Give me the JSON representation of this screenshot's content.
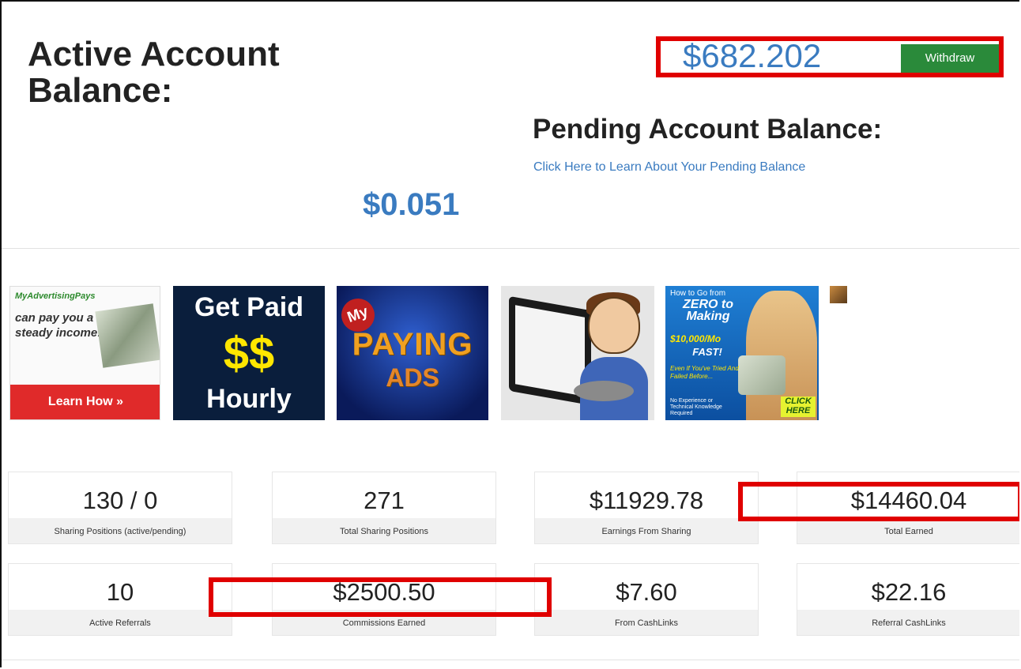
{
  "active_balance": {
    "title": "Active Account Balance:",
    "amount": "$682.202",
    "withdraw_label": "Withdraw"
  },
  "pending_balance": {
    "title": "Pending Account Balance:",
    "link_text": "Click Here to Learn About Your Pending Balance",
    "amount": "$0.051"
  },
  "ads": [
    {
      "brand": "MyAdvertisingPays",
      "text": "can pay you a steady income!",
      "button": "Learn How »"
    },
    {
      "line1": "Get Paid",
      "line2": "$$",
      "line3": "Hourly"
    },
    {
      "line1": "My",
      "line2": "PAYING",
      "line3": "ADS"
    },
    {
      "name": "cartoon-man-tablet"
    },
    {
      "line1": "How to Go from",
      "line2": "ZERO to Making",
      "line3": "$10,000/Mo",
      "line4": "FAST!",
      "line5": "Even If You've Tried And Failed Before...",
      "line6": "No Experience or Technical Knowledge Required",
      "cta": "CLICK HERE"
    }
  ],
  "stats_row1": [
    {
      "value": "130 / 0",
      "label": "Sharing Positions (active/pending)"
    },
    {
      "value": "271",
      "label": "Total Sharing Positions"
    },
    {
      "value": "$11929.78",
      "label": "Earnings From Sharing"
    },
    {
      "value": "$14460.04",
      "label": "Total Earned"
    }
  ],
  "stats_row2": [
    {
      "value": "10",
      "label": "Active Referrals"
    },
    {
      "value": "$2500.50",
      "label": "Commissions Earned"
    },
    {
      "value": "$7.60",
      "label": "From CashLinks"
    },
    {
      "value": "$22.16",
      "label": "Referral CashLinks"
    }
  ],
  "colors": {
    "accent_blue": "#3a7bc0",
    "withdraw_green": "#2a8a3a",
    "highlight_red": "#e00000"
  }
}
